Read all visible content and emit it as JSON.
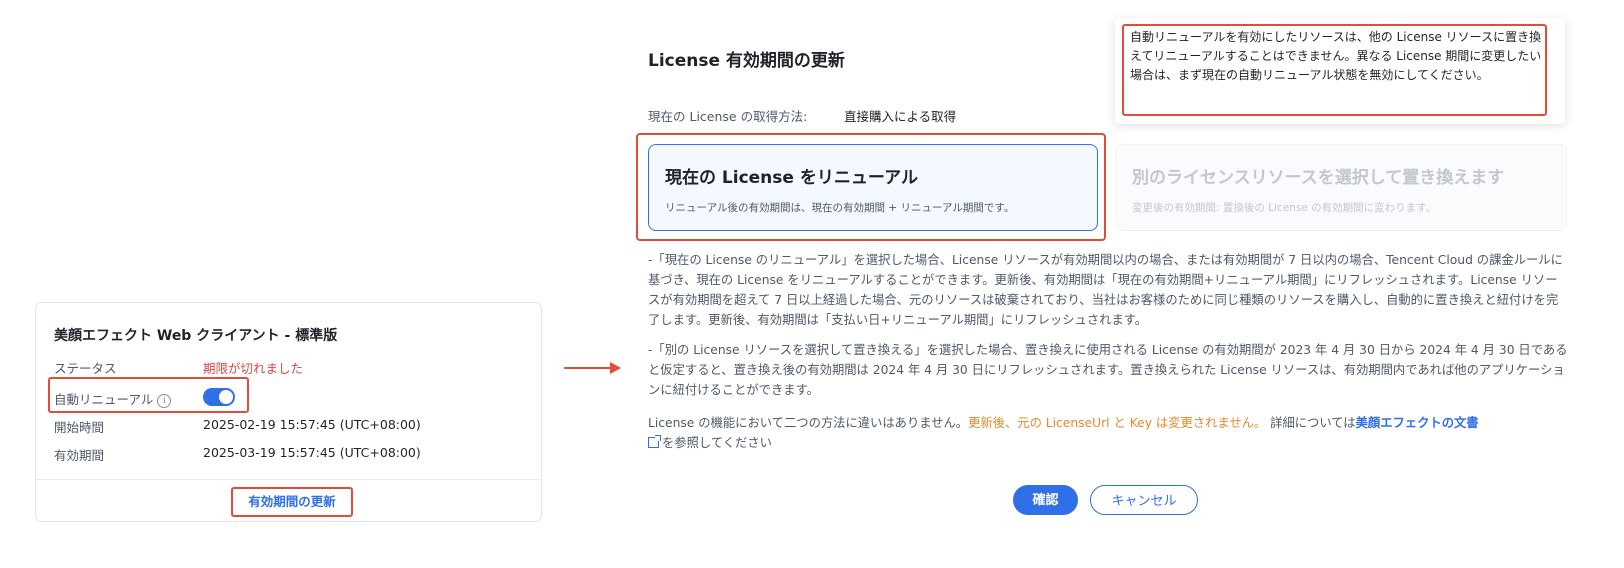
{
  "card": {
    "title": "美顔エフェクト Web クライアント - 標準版",
    "rows": [
      {
        "label": "ステータス",
        "value": "期限が切れました"
      },
      {
        "label": "自動リニューアル",
        "info_icon": "i"
      },
      {
        "label": "開始時間",
        "value": "2025-02-19 15:57:45 (UTC+08:00)"
      },
      {
        "label": "有効期間",
        "value": "2025-03-19 15:57:45 (UTC+08:00)"
      }
    ],
    "auto_renew_on": true,
    "renew_link": "有効期間の更新"
  },
  "dialog": {
    "title": "License 有効期間の更新",
    "method_label": "現在の License の取得方法:",
    "method_value": "直接購入による取得",
    "tooltip": "自動リニューアルを有効にしたリソースは、他の License リソースに置き換えてリニューアルすることはできません。異なる License 期間に変更したい場合は、まず現在の自動リニューアル状態を無効にしてください。",
    "options": [
      {
        "title": "現在の License をリニューアル",
        "desc": "リニューアル後の有効期間は、現在の有効期間 + リニューアル期間です。",
        "selected": true
      },
      {
        "title": "別のライセンスリソースを選択して置き換えます",
        "desc": "変更後の有効期間: 置換後の License の有効期間に変わります。",
        "disabled": true
      }
    ],
    "para1": "-「現在の License のリニューアル」を選択した場合、License リソースが有効期間以内の場合、または有効期間が 7 日以内の場合、Tencent Cloud の課金ルールに基づき、現在の License をリニューアルすることができます。更新後、有効期間は「現在の有効期間+リニューアル期間」にリフレッシュされます。License リソースが有効期間を超えて 7 日以上経過した場合、元のリソースは破棄されており、当社はお客様のために同じ種類のリソースを購入し、自動的に置き換えと紐付けを完了します。更新後、有効期間は「支払い日+リニューアル期間」にリフレッシュされます。",
    "para2": "-「別の License リソースを選択して置き換える」を選択した場合、置き換えに使用される License の有効期間が 2023 年 4 月 30 日から 2024 年 4 月 30 日であると仮定すると、置き換え後の有効期間は 2024 年 4 月 30 日にリフレッシュされます。置き換えられた License リソースは、有効期間内であれば他のアプリケーションに紐付けることができます。",
    "para3_prefix": "License の機能において二つの方法に違いはありません。",
    "para3_orange": "更新後、元の LicenseUrl と Key は変更されません。",
    "para3_mid": " 詳細については",
    "para3_link": "美顔エフェクトの文書",
    "para3_suffix": "を参照してください",
    "confirm": "確認",
    "cancel": "キャンセル"
  },
  "colors": {
    "accent": "#2f6fe8",
    "highlight": "#e04e3a",
    "expired": "#e54545",
    "notice": "#e8882a"
  },
  "icons": [
    "info-icon",
    "toggle-switch",
    "arrow-right-icon",
    "external-link-icon"
  ]
}
